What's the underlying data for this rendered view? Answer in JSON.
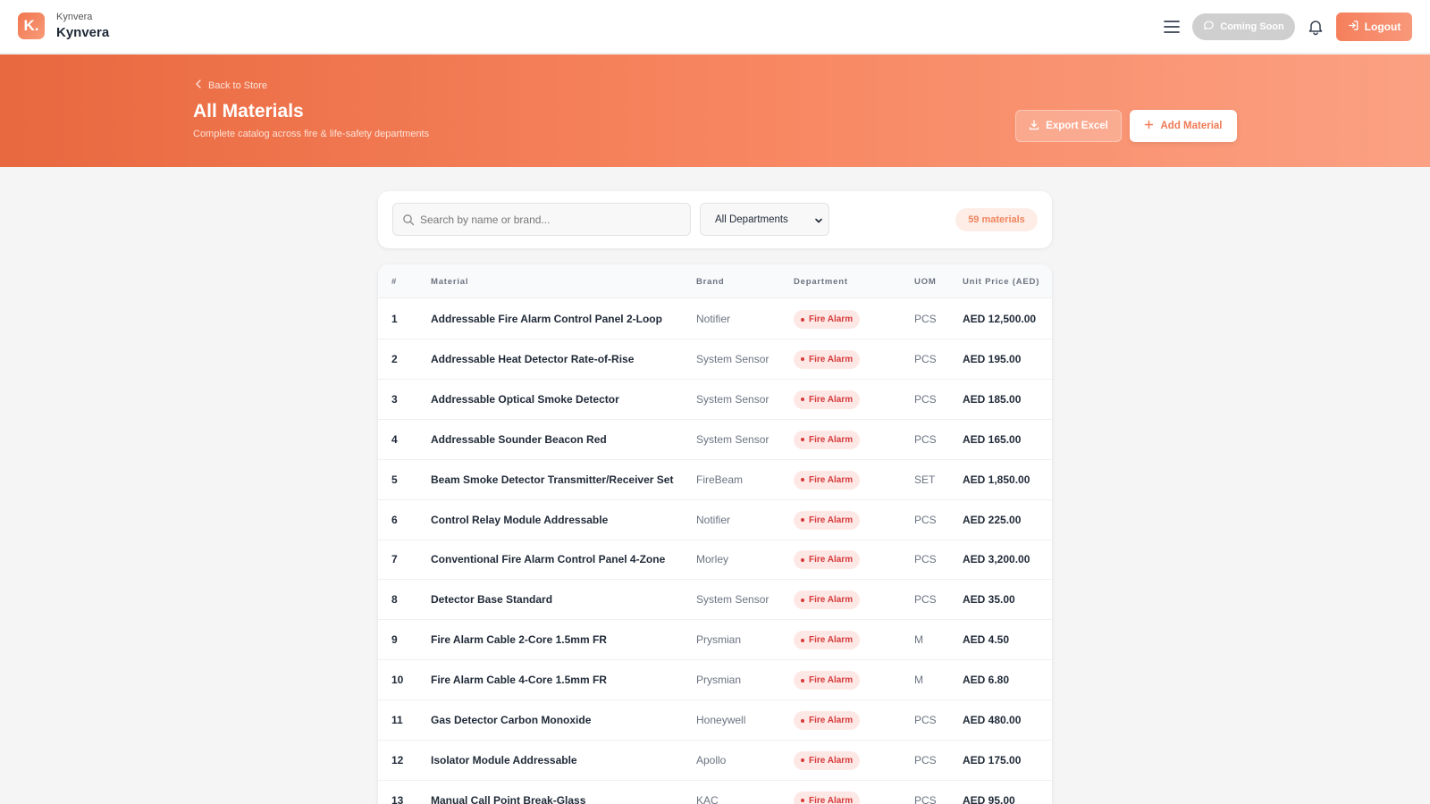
{
  "topbar": {
    "logo_letter": "K.",
    "brand_sub": "Kynvera",
    "brand_main": "Kynvera",
    "coming_soon_label": "Coming Soon",
    "logout_label": "Logout"
  },
  "hero": {
    "back_label": "Back to Store",
    "title": "All Materials",
    "subtitle": "Complete catalog across fire & life-safety departments",
    "export_label": "Export Excel",
    "add_label": "Add Material"
  },
  "filters": {
    "search_placeholder": "Search by name or brand...",
    "department_selected": "All Departments",
    "count_label": "59 materials"
  },
  "table": {
    "columns": [
      "#",
      "Material",
      "Brand",
      "Department",
      "UOM",
      "Unit Price (AED)"
    ],
    "rows": [
      {
        "num": "1",
        "name": "Addressable Fire Alarm Control Panel 2-Loop",
        "brand": "Notifier",
        "dept": "Fire Alarm",
        "uom": "PCS",
        "price": "AED 12,500.00"
      },
      {
        "num": "2",
        "name": "Addressable Heat Detector Rate-of-Rise",
        "brand": "System Sensor",
        "dept": "Fire Alarm",
        "uom": "PCS",
        "price": "AED 195.00"
      },
      {
        "num": "3",
        "name": "Addressable Optical Smoke Detector",
        "brand": "System Sensor",
        "dept": "Fire Alarm",
        "uom": "PCS",
        "price": "AED 185.00"
      },
      {
        "num": "4",
        "name": "Addressable Sounder Beacon Red",
        "brand": "System Sensor",
        "dept": "Fire Alarm",
        "uom": "PCS",
        "price": "AED 165.00"
      },
      {
        "num": "5",
        "name": "Beam Smoke Detector Transmitter/Receiver Set",
        "brand": "FireBeam",
        "dept": "Fire Alarm",
        "uom": "SET",
        "price": "AED 1,850.00"
      },
      {
        "num": "6",
        "name": "Control Relay Module Addressable",
        "brand": "Notifier",
        "dept": "Fire Alarm",
        "uom": "PCS",
        "price": "AED 225.00"
      },
      {
        "num": "7",
        "name": "Conventional Fire Alarm Control Panel 4-Zone",
        "brand": "Morley",
        "dept": "Fire Alarm",
        "uom": "PCS",
        "price": "AED 3,200.00"
      },
      {
        "num": "8",
        "name": "Detector Base Standard",
        "brand": "System Sensor",
        "dept": "Fire Alarm",
        "uom": "PCS",
        "price": "AED 35.00"
      },
      {
        "num": "9",
        "name": "Fire Alarm Cable 2-Core 1.5mm FR",
        "brand": "Prysmian",
        "dept": "Fire Alarm",
        "uom": "M",
        "price": "AED 4.50"
      },
      {
        "num": "10",
        "name": "Fire Alarm Cable 4-Core 1.5mm FR",
        "brand": "Prysmian",
        "dept": "Fire Alarm",
        "uom": "M",
        "price": "AED 6.80"
      },
      {
        "num": "11",
        "name": "Gas Detector Carbon Monoxide",
        "brand": "Honeywell",
        "dept": "Fire Alarm",
        "uom": "PCS",
        "price": "AED 480.00"
      },
      {
        "num": "12",
        "name": "Isolator Module Addressable",
        "brand": "Apollo",
        "dept": "Fire Alarm",
        "uom": "PCS",
        "price": "AED 175.00"
      },
      {
        "num": "13",
        "name": "Manual Call Point Break-Glass",
        "brand": "KAC",
        "dept": "Fire Alarm",
        "uom": "PCS",
        "price": "AED 95.00"
      }
    ]
  },
  "colors": {
    "accent": "#f07a55",
    "hero_start": "#e8683f",
    "hero_end": "#fba183",
    "dept_badge_text": "#d63a3a",
    "dept_badge_bg": "#fde8e6"
  }
}
